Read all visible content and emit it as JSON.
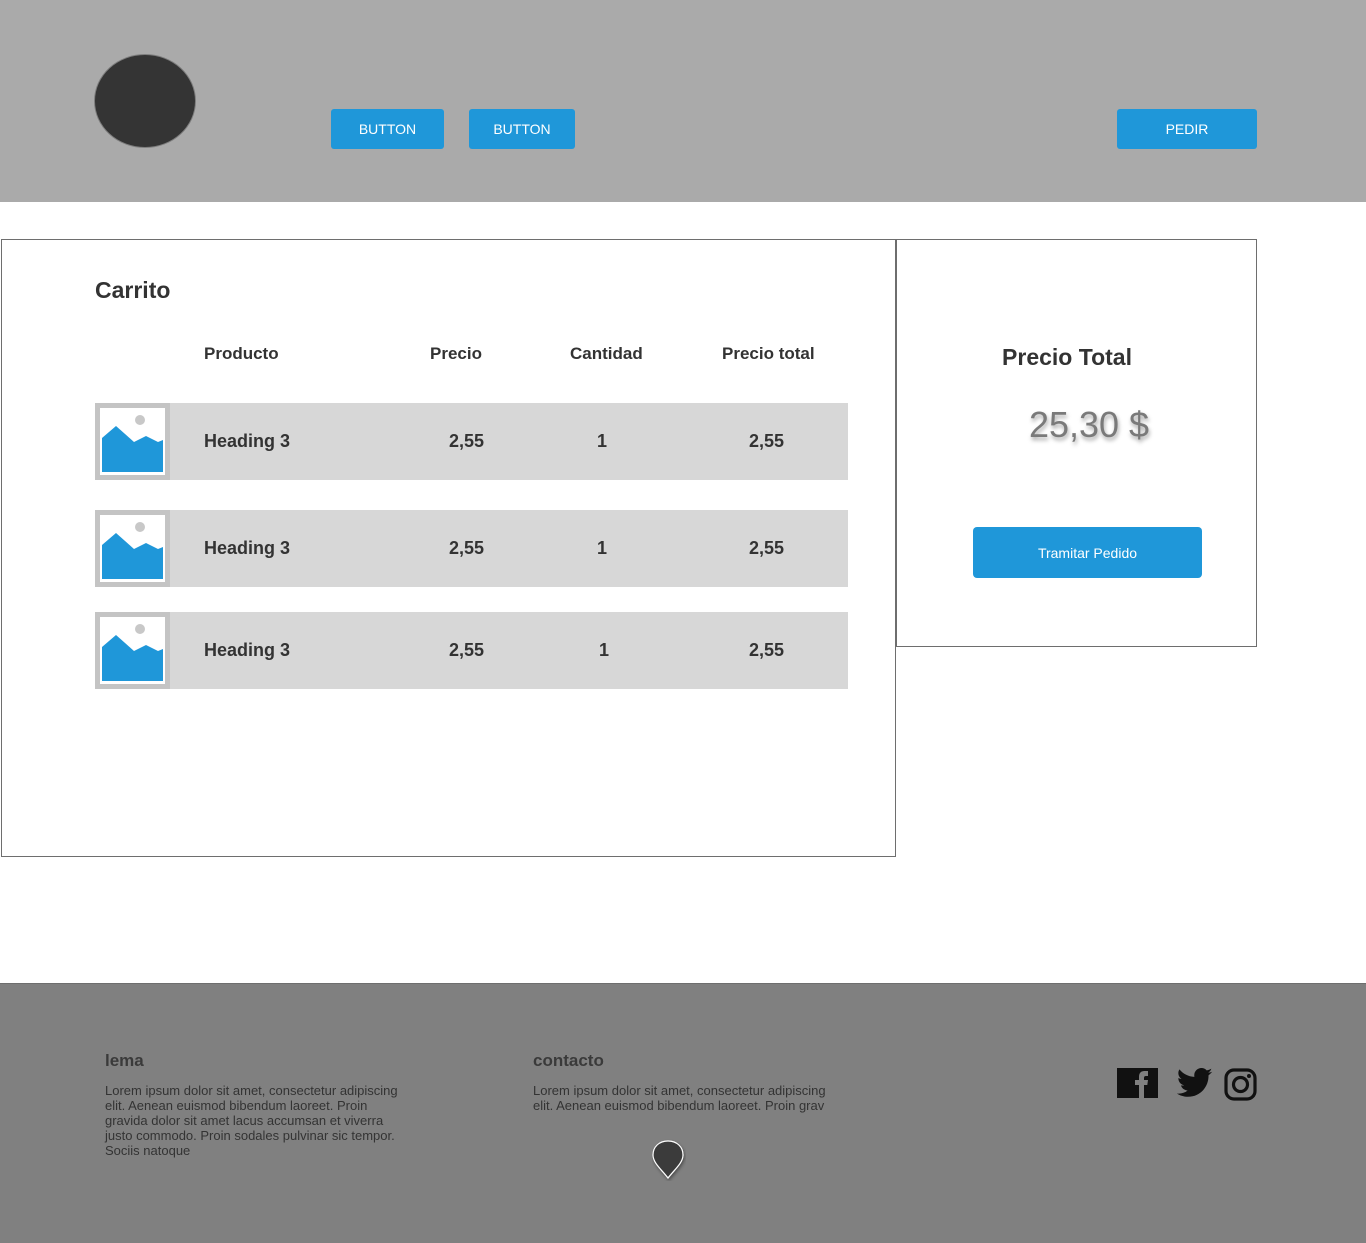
{
  "header": {
    "logo": "avatar-circle",
    "buttons": [
      "BUTTON",
      "BUTTON"
    ],
    "order_button": "PEDIR"
  },
  "cart": {
    "title": "Carrito",
    "columns": [
      "Producto",
      "Precio",
      "Cantidad",
      "Precio total"
    ],
    "rows": [
      {
        "name": "Heading 3",
        "price": "2,55",
        "qty": "1",
        "total": "2,55"
      },
      {
        "name": "Heading 3",
        "price": "2,55",
        "qty": "1",
        "total": "2,55"
      },
      {
        "name": "Heading 3",
        "price": "2,55",
        "qty": "1",
        "total": "2,55"
      }
    ]
  },
  "summary": {
    "title": "Precio Total",
    "amount": "25,30 $",
    "checkout_button": "Tramitar Pedido"
  },
  "footer": {
    "lema": {
      "heading": "lema",
      "text": "Lorem ipsum dolor sit amet, consectetur adipiscing elit. Aenean euismod bibendum laoreet. Proin gravida dolor sit amet lacus accumsan et viverra justo commodo. Proin sodales pulvinar sic tempor. Sociis natoque"
    },
    "contacto": {
      "heading": "contacto",
      "text": "Lorem ipsum dolor sit amet, consectetur adipiscing elit. Aenean euismod bibendum laoreet. Proin grav"
    },
    "icons": [
      "map-pin-icon",
      "facebook-icon",
      "twitter-icon",
      "instagram-icon"
    ]
  },
  "colors": {
    "header_bg": "#aaaaaa",
    "accent": "#1f97d9",
    "row_bg": "#d7d7d7",
    "footer_bg": "#808080"
  }
}
